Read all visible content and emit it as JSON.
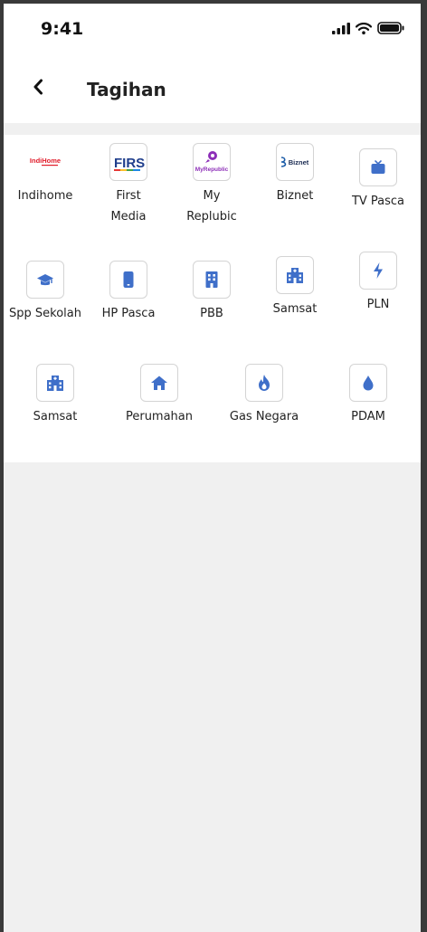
{
  "status_bar": {
    "time": "9:41"
  },
  "header": {
    "title": "Tagihan"
  },
  "logos": {
    "indihome": "IndiHome",
    "first": "FIRST",
    "myrepublic": "MyRepublic",
    "biznet": "Biznet"
  },
  "colors": {
    "accent": "#3f6fc9",
    "indihome_red": "#e11d2b",
    "myrepublic_purple": "#8d2fb8"
  },
  "items": [
    {
      "label": "Indihome",
      "icon": "indihome-logo"
    },
    {
      "label": "First",
      "label2": "Media",
      "icon": "first-media-logo"
    },
    {
      "label": "My",
      "label2": "Replubic",
      "icon": "myrepublic-logo"
    },
    {
      "label": "Biznet",
      "icon": "biznet-logo"
    },
    {
      "label": "TV Pasca",
      "icon": "tv-icon"
    },
    {
      "label": "Spp Sekolah",
      "icon": "graduation-cap-icon"
    },
    {
      "label": "HP Pasca",
      "icon": "phone-icon"
    },
    {
      "label": "PBB",
      "icon": "building-icon"
    },
    {
      "label": "Samsat",
      "icon": "hospital-building-icon"
    },
    {
      "label": "PLN",
      "icon": "lightning-icon"
    },
    {
      "label": "Samsat",
      "icon": "hospital-building-icon"
    },
    {
      "label": "Perumahan",
      "icon": "house-icon"
    },
    {
      "label": "Gas Negara",
      "icon": "flame-icon"
    },
    {
      "label": "PDAM",
      "icon": "water-drop-icon"
    }
  ]
}
